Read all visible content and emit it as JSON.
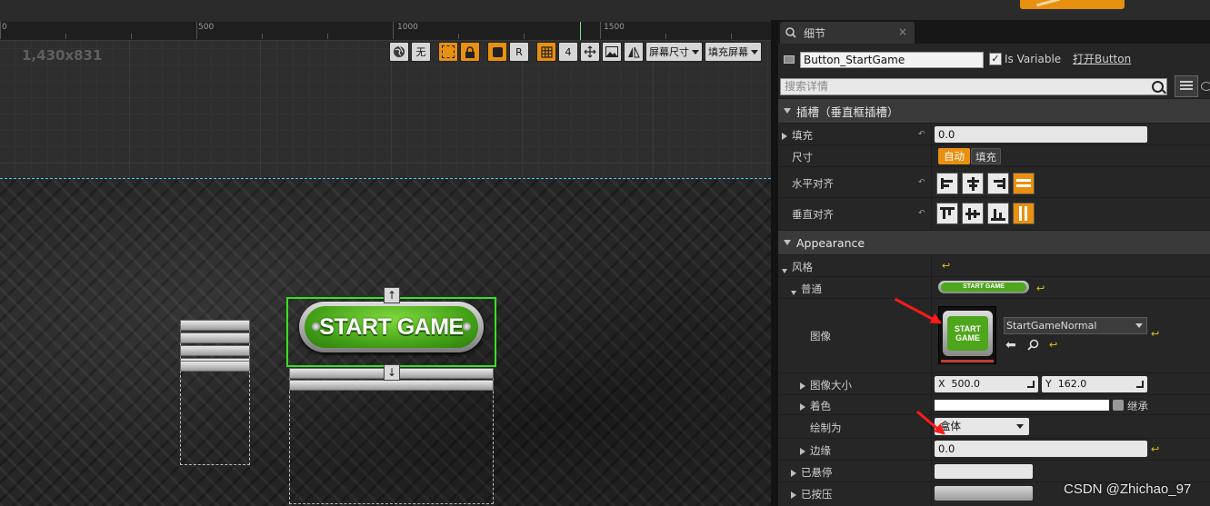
{
  "designer": {
    "ruler_labels": [
      "0",
      "500",
      "1000",
      "1500"
    ],
    "resolution": "1,430x831",
    "toolbar": {
      "globe_icon": "globe-icon",
      "none_label": "无",
      "r_label": "R",
      "snap_value": "4",
      "screen_size_label": "屏幕尺寸",
      "fill_screen_label": "填充屏幕"
    },
    "button_text": "START GAME",
    "up_arrow": "↑",
    "down_arrow": "↓"
  },
  "details": {
    "tab_title": "细节",
    "tab_close": "×",
    "widget_name": "Button_StartGame",
    "is_variable_checked": "✓",
    "is_variable_label": "Is Variable",
    "open_button_label": "打开Button",
    "search_placeholder": "搜索详情",
    "slot_section": "插槽（垂直框插槽）",
    "padding_label": "填充",
    "padding_value": "0.0",
    "size_label": "尺寸",
    "size_auto": "自动",
    "size_fill": "填充",
    "halign_label": "水平对齐",
    "valign_label": "垂直对齐",
    "appearance_section": "Appearance",
    "style_label": "风格",
    "normal_label": "普通",
    "thumb_text": "START GAME",
    "image_label": "图像",
    "image_preview_text": "START GAME",
    "image_asset": "StartGameNormal",
    "image_size_label": "图像大小",
    "image_size_x_label": "X",
    "image_size_x": "500.0",
    "image_size_y_label": "Y",
    "image_size_y": "162.0",
    "tint_label": "着色",
    "inherit_label": "继承",
    "draw_as_label": "绘制为",
    "draw_as_value": "盒体",
    "margin_label": "边缘",
    "margin_value": "0.0",
    "hovered_label": "已悬停",
    "pressed_label": "已按压"
  },
  "watermark": "CSDN @Zhichao_97",
  "colors": {
    "accent_orange": "#e8900f",
    "selection_green": "#37e21f",
    "button_green": "#4ea61c",
    "annotation_red": "#ff1a1a"
  }
}
